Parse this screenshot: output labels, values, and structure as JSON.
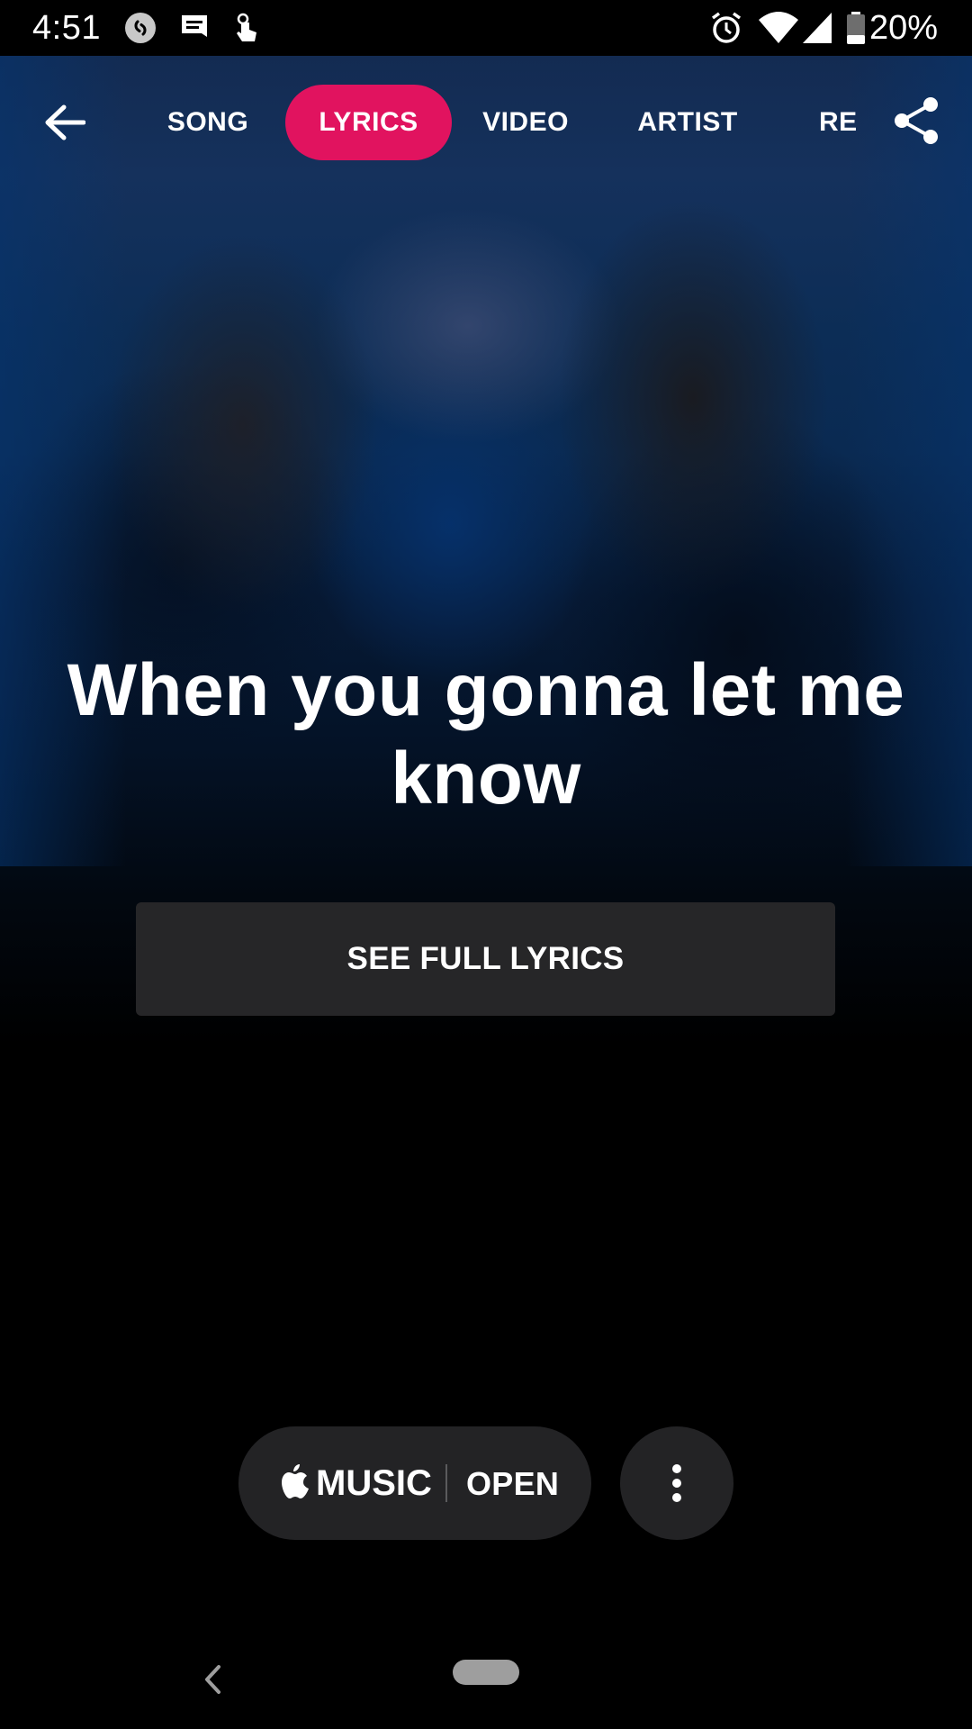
{
  "status_bar": {
    "time": "4:51",
    "battery_percent": "20%",
    "left_icons": [
      "shazam-icon",
      "message-icon",
      "touch-icon"
    ],
    "right_icons": [
      "alarm-icon",
      "wifi-icon",
      "signal-icon",
      "battery-icon"
    ]
  },
  "nav": {
    "tabs": [
      {
        "label": "SONG",
        "active": false
      },
      {
        "label": "LYRICS",
        "active": true
      },
      {
        "label": "VIDEO",
        "active": false
      },
      {
        "label": "ARTIST",
        "active": false
      },
      {
        "label": "RELATED",
        "active": false
      }
    ],
    "accent_color": "#e1135f"
  },
  "lyrics": {
    "line": "When you gonna let me know",
    "see_full_button": "SEE FULL LYRICS"
  },
  "player": {
    "service_label": "MUSIC",
    "open_label": "OPEN"
  }
}
